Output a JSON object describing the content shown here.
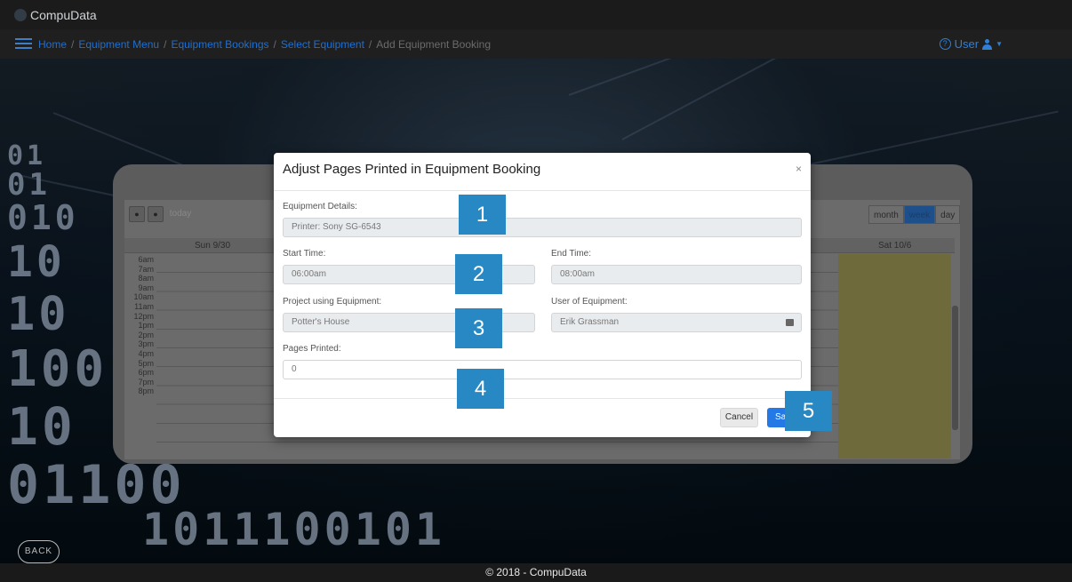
{
  "app": {
    "title": "CompuData"
  },
  "breadcrumb": {
    "items": [
      "Home",
      "Equipment Menu",
      "Equipment Bookings",
      "Select Equipment"
    ],
    "current": "Add Equipment Booking",
    "separator": "/"
  },
  "user_menu": {
    "label": "User"
  },
  "calendar": {
    "today_label": "today",
    "views": [
      "month",
      "week",
      "day"
    ],
    "active_view": "week",
    "first_day_header": "Sun 9/30",
    "last_day_header": "Sat 10/6",
    "times": [
      "6am",
      "7am",
      "8am",
      "9am",
      "10am",
      "11am",
      "12pm",
      "1pm",
      "2pm",
      "3pm",
      "4pm",
      "5pm",
      "6pm",
      "7pm",
      "8pm"
    ]
  },
  "modal": {
    "title": "Adjust Pages Printed in Equipment Booking",
    "close_label": "×",
    "fields": {
      "equipment_details": {
        "label": "Equipment Details:",
        "value": "Printer: Sony SG-6543"
      },
      "start_time": {
        "label": "Start Time:",
        "value": "06:00am"
      },
      "end_time": {
        "label": "End Time:",
        "value": "08:00am"
      },
      "project": {
        "label": "Project using Equipment:",
        "value": "Potter's House"
      },
      "user": {
        "label": "User of Equipment:",
        "value": "Erik Grassman"
      },
      "pages_printed": {
        "label": "Pages Printed:",
        "value": "0"
      }
    },
    "cancel_label": "Cancel",
    "save_label": "Save"
  },
  "callouts": [
    "1",
    "2",
    "3",
    "4",
    "5"
  ],
  "back_label": "BACK",
  "footer": {
    "text": "© 2018 - CompuData"
  },
  "colors": {
    "accent": "#2479e6",
    "callout": "#2788c4",
    "link": "#1f6fd0"
  }
}
